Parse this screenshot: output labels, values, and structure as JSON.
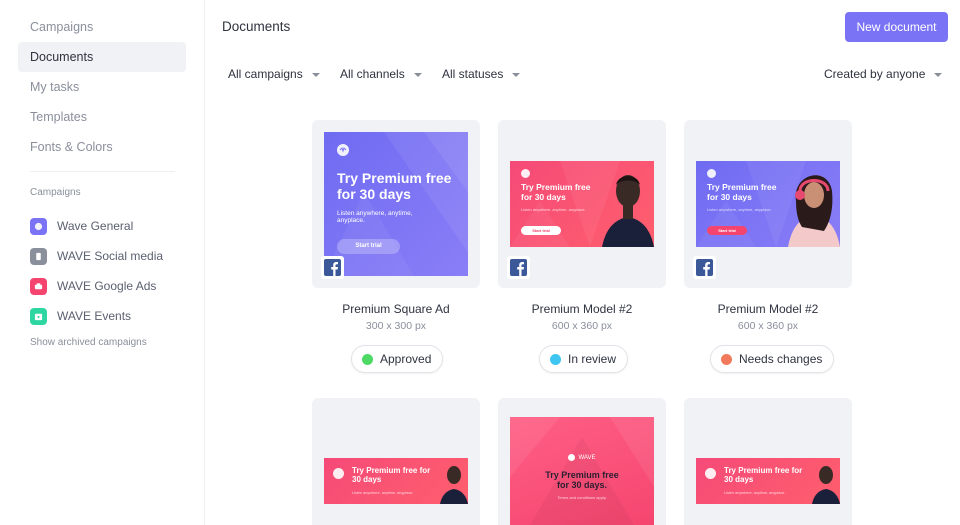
{
  "sidebar": {
    "nav": [
      "Campaigns",
      "Documents",
      "My tasks",
      "Templates",
      "Fonts & Colors"
    ],
    "section_label": "Campaigns",
    "campaigns": [
      {
        "label": "Wave General",
        "color": "#7b73f5"
      },
      {
        "label": "WAVE Social media",
        "color": "#8a8f9c"
      },
      {
        "label": "WAVE Google Ads",
        "color": "#f5456f"
      },
      {
        "label": "WAVE Events",
        "color": "#2ed6a1"
      }
    ],
    "archived_link": "Show archived campaigns"
  },
  "header": {
    "title": "Documents",
    "new_button": "New document"
  },
  "filters": {
    "campaigns": "All campaigns",
    "channels": "All channels",
    "statuses": "All statuses",
    "created_by": "Created by anyone"
  },
  "colors": {
    "accent": "#7b73f5",
    "pink": "#f5456f",
    "approved": "#4cd964",
    "in_review": "#3ec6f0",
    "needs_changes": "#f27a5c"
  },
  "cards": [
    {
      "name": "Premium Square Ad",
      "size": "300 x 300 px",
      "status": "Approved",
      "ad": {
        "headline": "Try Premium free for 30 days",
        "sub": "Listen anywhere, anytime, anyplace.",
        "button": "Start trial"
      }
    },
    {
      "name": "Premium Model #2",
      "size": "600 x 360 px",
      "status": "In review",
      "ad": {
        "headline": "Try Premium free for 30 days",
        "sub": "Listen anywhere, anytime, anyplace.",
        "button": "Start trial"
      }
    },
    {
      "name": "Premium Model #2",
      "size": "600 x 360 px",
      "status": "Needs changes",
      "ad": {
        "headline": "Try Premium free for 30 days",
        "sub": "Listen anywhere, anytime, anyplace.",
        "button": "Start trial"
      }
    },
    {
      "ad": {
        "headline": "Try Premium free for 30 days",
        "sub": "Listen anywhere, anytime, anyplace."
      }
    },
    {
      "ad": {
        "brand": "WAVE",
        "headline": "Try Premium free for 30 days.",
        "sub": "Terms and conditions apply."
      }
    },
    {
      "ad": {
        "headline": "Try Premium free for 30 days",
        "sub": "Listen anywhere, anytime, anyplace."
      }
    }
  ]
}
